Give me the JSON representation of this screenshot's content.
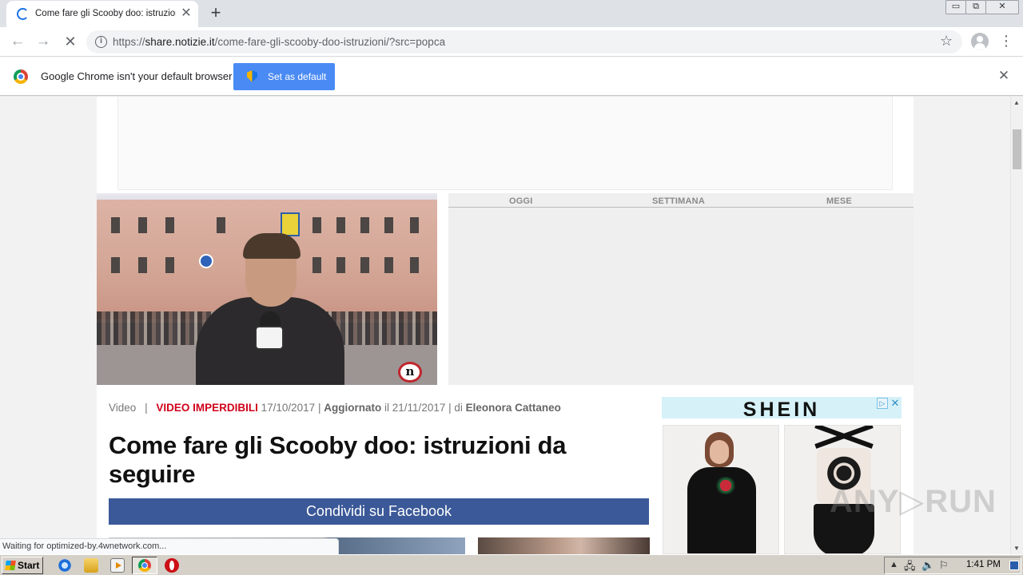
{
  "browser": {
    "tab": {
      "title": "Come fare gli Scooby doo: istruzioni da seguire",
      "close_glyph": "✕"
    },
    "new_tab_glyph": "+",
    "window_controls": {
      "minimize": "▭",
      "maximize": "⧉",
      "close": "✕"
    },
    "nav": {
      "back": "←",
      "forward": "→",
      "stop": "✕"
    },
    "address": {
      "prefix": "https://",
      "host": "share.notizie.it",
      "path": "/come-fare-gli-scooby-doo-istruzioni/?src=popca"
    },
    "info_glyph": "i",
    "star_glyph": "☆",
    "menu_glyph": "⋮",
    "infobar": {
      "message": "Google Chrome isn't your default browser",
      "button_label": "Set as default",
      "close_glyph": "✕"
    },
    "status_text": "Waiting for optimized-by.4wnetwork.com..."
  },
  "page": {
    "video": {
      "logo_text": "n"
    },
    "period_tabs": [
      "OGGI",
      "SETTIMANA",
      "MESE"
    ],
    "meta": {
      "section": "Video",
      "separator": "|",
      "category": "VIDEO IMPERDIBILI",
      "date": "17/10/2017",
      "pipe": "|",
      "updated_label": "Aggiornato",
      "updated_prefix": "il",
      "updated_date": "21/11/2017",
      "author_prefix": "| di",
      "author": "Eleonora Cattaneo"
    },
    "headline": "Come fare gli Scooby doo: istruzioni da seguire",
    "facebook_button": "Condividi su Facebook",
    "ad": {
      "brand": "SHEIN",
      "adchoices_glyph": "▷",
      "close_glyph": "✕"
    },
    "watermark": "ANY▷RUN"
  },
  "scrollbar": {
    "up": "▲",
    "down": "▼"
  },
  "taskbar": {
    "start_label": "Start",
    "clock": "1:41 PM",
    "tray": {
      "up": "▲",
      "network": "🖧",
      "volume": "🔈",
      "flag": "⚐"
    },
    "ie_glyph": "e"
  },
  "icons": [
    "tab-spinner-icon",
    "info-icon",
    "star-icon",
    "profile-icon",
    "menu-icon",
    "chrome-logo-icon",
    "shield-icon",
    "adchoices-icon",
    "windows-logo-icon",
    "ie-icon",
    "folder-icon",
    "media-player-icon",
    "chrome-icon",
    "opera-icon",
    "network-icon",
    "volume-icon",
    "flag-icon"
  ],
  "colors": {
    "accent": "#4a8af4",
    "facebook": "#3b5998",
    "category_red": "#d0021b",
    "shein_bar": "#d6f1f8"
  }
}
